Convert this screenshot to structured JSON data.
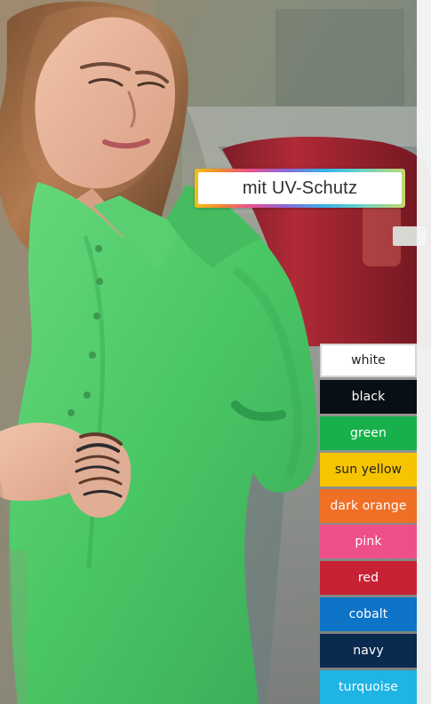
{
  "badge": {
    "text": "mit UV-Schutz"
  },
  "swatches": [
    {
      "label": "white",
      "bg": "#ffffff",
      "fg": "#1f1f1f"
    },
    {
      "label": "black",
      "bg": "#081016",
      "fg": "#ffffff"
    },
    {
      "label": "green",
      "bg": "#18b04a",
      "fg": "#ffffff"
    },
    {
      "label": "sun yellow",
      "bg": "#f7c400",
      "fg": "#1f1f1f"
    },
    {
      "label": "dark orange",
      "bg": "#ef6f25",
      "fg": "#ffffff"
    },
    {
      "label": "pink",
      "bg": "#ef4f88",
      "fg": "#ffffff"
    },
    {
      "label": "red",
      "bg": "#c72234",
      "fg": "#ffffff"
    },
    {
      "label": "cobalt",
      "bg": "#0d74c8",
      "fg": "#ffffff"
    },
    {
      "label": "navy",
      "bg": "#0b2a4f",
      "fg": "#ffffff"
    },
    {
      "label": "turquoise",
      "bg": "#1eb4e3",
      "fg": "#ffffff"
    }
  ]
}
